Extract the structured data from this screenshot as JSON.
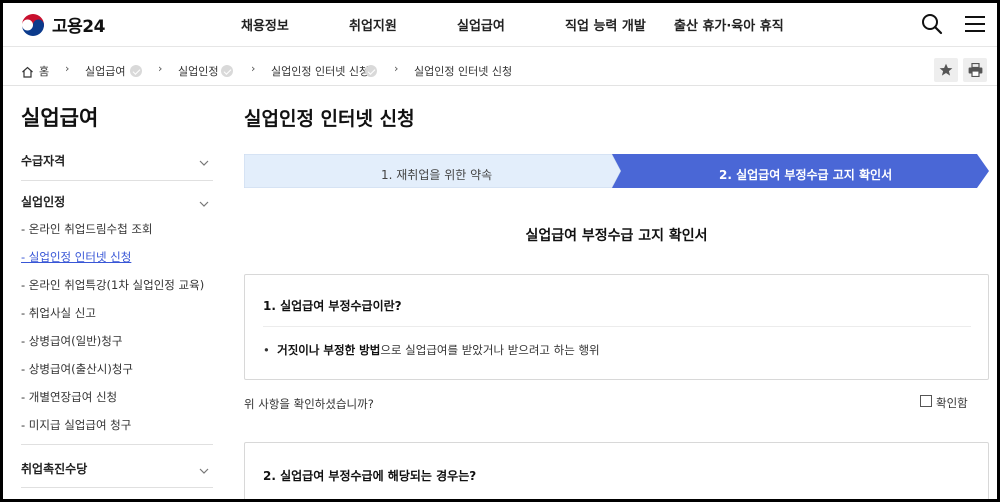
{
  "header": {
    "logo_text": "고용24",
    "nav": [
      "채용정보",
      "취업지원",
      "실업급여",
      "직업 능력 개발",
      "출산 휴가·육아 휴직"
    ]
  },
  "breadcrumb": {
    "home": "홈",
    "items": [
      "실업급여",
      "실업인정",
      "실업인정 인터넷 신청",
      "실업인정 인터넷 신청"
    ]
  },
  "sidebar": {
    "title": "실업급여",
    "sections": [
      "수급자격",
      "실업인정",
      "취업촉진수당"
    ],
    "items": [
      "- 온라인 취업드림수첩 조회",
      "- 실업인정 인터넷 신청",
      "- 온라인 취업특강(1차 실업인정 교육)",
      "- 취업사실 신고",
      "- 상병급여(일반)청구",
      "- 상병급여(출산시)청구",
      "- 개별연장급여 신청",
      "- 미지급 실업급여 청구"
    ]
  },
  "main": {
    "title": "실업인정 인터넷 신청",
    "steps": [
      "1. 재취업을 위한 약속",
      "2. 실업급여 부정수급 고지 확인서"
    ],
    "doc_title": "실업급여 부정수급 고지 확인서",
    "q1": "1. 실업급여 부정수급이란?",
    "a1_bullet": "•",
    "a1_bold": "거짓이나 부정한 방법",
    "a1_rest": "으로 실업급여를 받았거나 받으려고 하는 행위",
    "confirm_question": "위 사항을 확인하셨습니까?",
    "confirm_label": "확인함",
    "q2": "2. 실업급여 부정수급에 해당되는 경우는?"
  },
  "colors": {
    "step_active": "#4a67d6",
    "step_inactive": "#e3eefb",
    "link_active": "#3856d6"
  }
}
